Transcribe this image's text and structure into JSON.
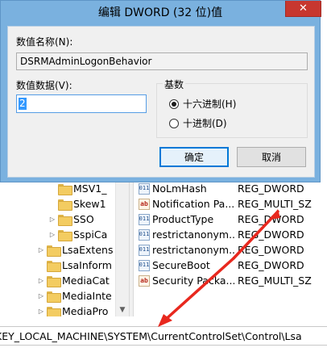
{
  "dialog": {
    "title": "编辑 DWORD (32 位)值",
    "close_glyph": "✕",
    "value_name_label": "数值名称(N):",
    "value_name": "DSRMAdminLogonBehavior",
    "value_data_label": "数值数据(V):",
    "value_data": "2",
    "base_label": "基数",
    "base_options": [
      {
        "label": "十六进制(H)",
        "selected": true
      },
      {
        "label": "十进制(D)",
        "selected": false
      }
    ],
    "ok_label": "确定",
    "cancel_label": "取消"
  },
  "tree": {
    "items": [
      {
        "label": "MSV1_",
        "arrow": ""
      },
      {
        "label": "Skew1",
        "arrow": ""
      },
      {
        "label": "SSO",
        "arrow": "▷"
      },
      {
        "label": "SspiCa",
        "arrow": "▷"
      },
      {
        "label": "LsaExtens",
        "arrow": "▷"
      },
      {
        "label": "LsaInform",
        "arrow": ""
      },
      {
        "label": "MediaCat",
        "arrow": "▷"
      },
      {
        "label": "MediaInte",
        "arrow": "▷"
      },
      {
        "label": "MediaPro",
        "arrow": "▷"
      }
    ],
    "scroll_down_glyph": "▼"
  },
  "values": {
    "rows": [
      {
        "name": "NoLmHash",
        "type": "REG_DWORD",
        "icon": "dword-icon"
      },
      {
        "name": "Notification Pa...",
        "type": "REG_MULTI_SZ",
        "icon": "string-icon"
      },
      {
        "name": "ProductType",
        "type": "REG_DWORD",
        "icon": "dword-icon"
      },
      {
        "name": "restrictanonym...",
        "type": "REG_DWORD",
        "icon": "dword-icon"
      },
      {
        "name": "restrictanonym...",
        "type": "REG_DWORD",
        "icon": "dword-icon"
      },
      {
        "name": "SecureBoot",
        "type": "REG_DWORD",
        "icon": "dword-icon"
      },
      {
        "name": "Security Packa...",
        "type": "REG_MULTI_SZ",
        "icon": "string-icon"
      }
    ],
    "dword_icon_text": "011",
    "string_icon_text": "ab"
  },
  "statusbar": {
    "path": "KEY_LOCAL_MACHINE\\SYSTEM\\CurrentControlSet\\Control\\Lsa"
  },
  "colors": {
    "annotation": "#e8281e",
    "titlebar": "#7ab1df",
    "close": "#c7372f"
  }
}
